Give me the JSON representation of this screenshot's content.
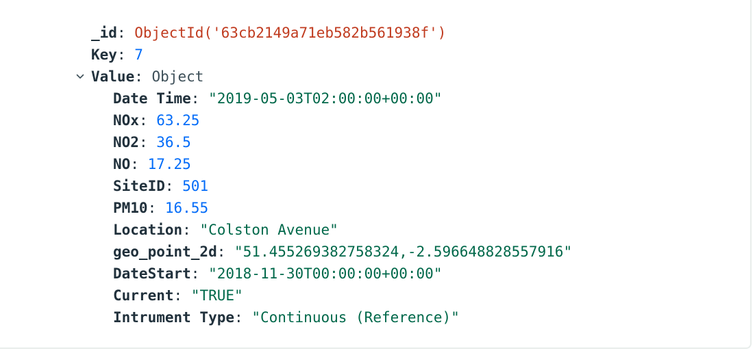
{
  "document": {
    "id_field": {
      "key": "_id",
      "value": "ObjectId('63cb2149a71eb582b561938f')"
    },
    "key_field": {
      "key": "Key",
      "value": "7"
    },
    "value_field": {
      "key": "Value",
      "type_label": "Object",
      "expanded": true,
      "toggle_icon": "chevron-down-icon",
      "children": [
        {
          "key": "Date Time",
          "value": "\"2019-05-03T02:00:00+00:00\"",
          "kind": "string"
        },
        {
          "key": "NOx",
          "value": "63.25",
          "kind": "number"
        },
        {
          "key": "NO2",
          "value": "36.5",
          "kind": "number"
        },
        {
          "key": "NO",
          "value": "17.25",
          "kind": "number"
        },
        {
          "key": "SiteID",
          "value": "501",
          "kind": "number"
        },
        {
          "key": "PM10",
          "value": "16.55",
          "kind": "number"
        },
        {
          "key": "Location",
          "value": "\"Colston Avenue\"",
          "kind": "string"
        },
        {
          "key": "geo_point_2d",
          "value": "\"51.455269382758324,-2.596648828557916\"",
          "kind": "string"
        },
        {
          "key": "DateStart",
          "value": "\"2018-11-30T00:00:00+00:00\"",
          "kind": "string"
        },
        {
          "key": "Current",
          "value": "\"TRUE\"",
          "kind": "string"
        },
        {
          "key": "Intrument Type",
          "value": "\"Continuous (Reference)\"",
          "kind": "string"
        }
      ]
    }
  },
  "colors": {
    "key": "#21313c",
    "objectid": "#c03b1f",
    "number": "#016bf8",
    "string": "#00684a",
    "card_border": "#e8edeb"
  }
}
